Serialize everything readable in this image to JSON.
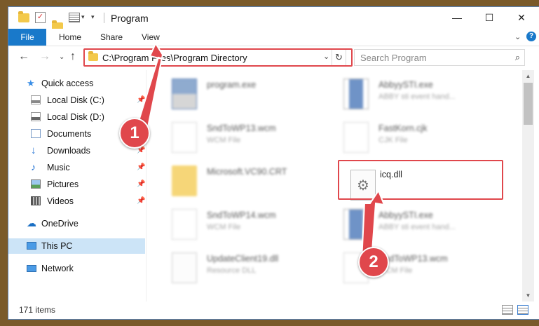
{
  "window": {
    "title": "Program",
    "controls": {
      "minimize": "—",
      "maximize": "☐",
      "close": "✕"
    }
  },
  "ribbon": {
    "tabs": [
      "File",
      "Home",
      "Share",
      "View"
    ],
    "expand": "⌄",
    "help": "?"
  },
  "nav": {
    "back": "←",
    "forward": "→",
    "recent": "⌄",
    "up": "↑",
    "address": "C:\\Program Files\\Program Directory",
    "address_dropdown": "⌄",
    "refresh": "↻",
    "search_placeholder": "Search Program",
    "search_icon": "⌕"
  },
  "sidebar": {
    "items": [
      {
        "label": "Quick access",
        "icon": "star-icon",
        "pinned": false
      },
      {
        "label": "Local Disk (C:)",
        "icon": "drive-icon",
        "pinned": true
      },
      {
        "label": "Local Disk (D:)",
        "icon": "drive-icon",
        "pinned": false
      },
      {
        "label": "Documents",
        "icon": "documents-icon",
        "pinned": true
      },
      {
        "label": "Downloads",
        "icon": "downloads-icon",
        "pinned": true
      },
      {
        "label": "Music",
        "icon": "music-icon",
        "pinned": true
      },
      {
        "label": "Pictures",
        "icon": "pictures-icon",
        "pinned": true
      },
      {
        "label": "Videos",
        "icon": "videos-icon",
        "pinned": true
      },
      {
        "label": "OneDrive",
        "icon": "cloud-icon",
        "pinned": false
      },
      {
        "label": "This PC",
        "icon": "computer-icon",
        "pinned": false,
        "selected": true
      },
      {
        "label": "Network",
        "icon": "network-icon",
        "pinned": false
      }
    ],
    "pin_glyph": "📌"
  },
  "files": [
    {
      "name": "program.exe",
      "type": ""
    },
    {
      "name": "AbbyySTI.exe",
      "type": "ABBY sti event hand..."
    },
    {
      "name": "SndToWP13.wcm",
      "type": "WCM File"
    },
    {
      "name": "FastKorn.cjk",
      "type": "CJK File"
    },
    {
      "name": "Microsoft.VC90.CRT",
      "type": ""
    },
    {
      "name": "icq.dll",
      "type": ""
    },
    {
      "name": "SndToWP14.wcm",
      "type": "WCM File"
    },
    {
      "name": "AbbyySTI.exe",
      "type": "ABBY sti event hand..."
    },
    {
      "name": "UpdateClient19.dll",
      "type": "Resource DLL"
    },
    {
      "name": "SndToWP13.wcm",
      "type": "WCM File"
    }
  ],
  "status": {
    "item_count": "171 items"
  },
  "callouts": {
    "first": "1",
    "second": "2"
  },
  "colors": {
    "accent": "#1979ca",
    "highlight": "#e0474c",
    "selected": "#cce4f7"
  }
}
